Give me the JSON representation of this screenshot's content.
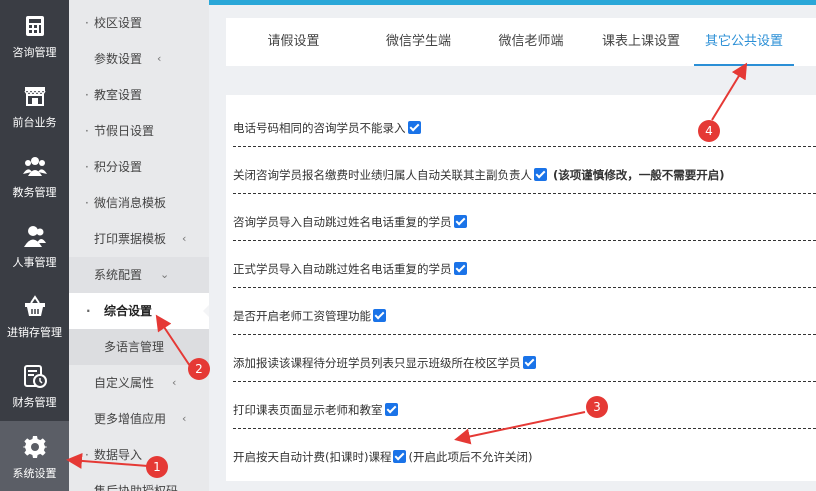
{
  "rail": [
    {
      "label": "咨询管理",
      "icon": "calculator-icon"
    },
    {
      "label": "前台业务",
      "icon": "storefront-icon"
    },
    {
      "label": "教务管理",
      "icon": "group-icon"
    },
    {
      "label": "人事管理",
      "icon": "people-icon"
    },
    {
      "label": "进销存管理",
      "icon": "basket-icon"
    },
    {
      "label": "财务管理",
      "icon": "finance-icon"
    },
    {
      "label": "系统设置",
      "icon": "gear-icon"
    }
  ],
  "submenu": [
    {
      "label": "校区设置"
    },
    {
      "label": "参数设置",
      "chevron": "‹"
    },
    {
      "label": "教室设置"
    },
    {
      "label": "节假日设置"
    },
    {
      "label": "积分设置"
    },
    {
      "label": "微信消息模板"
    },
    {
      "label": "打印票据模板",
      "chevron": "‹"
    },
    {
      "label": "系统配置",
      "chevron": "⌄"
    },
    {
      "label": "综合设置"
    },
    {
      "label": "多语言管理"
    },
    {
      "label": "自定义属性",
      "chevron": "‹"
    },
    {
      "label": "更多增值应用",
      "chevron": "‹"
    },
    {
      "label": "数据导入"
    },
    {
      "label": "售后协助授权码"
    }
  ],
  "tabs": [
    "请假设置",
    "微信学生端",
    "微信老师端",
    "课表上课设置",
    "其它公共设置"
  ],
  "settings": [
    {
      "text": "电话号码相同的咨询学员不能录入",
      "checked": true,
      "note": ""
    },
    {
      "text": "关闭咨询学员报名缴费时业绩归属人自动关联其主副负责人",
      "checked": true,
      "note": "(该项谨慎修改，一般不需要开启)"
    },
    {
      "text": "咨询学员导入自动跳过姓名电话重复的学员",
      "checked": true,
      "note": ""
    },
    {
      "text": "正式学员导入自动跳过姓名电话重复的学员",
      "checked": true,
      "note": ""
    },
    {
      "text": "是否开启老师工资管理功能",
      "checked": true,
      "note": ""
    },
    {
      "text": "添加报读该课程待分班学员列表只显示班级所在校区学员",
      "checked": true,
      "note": ""
    },
    {
      "text": "打印课表页面显示老师和教室",
      "checked": true,
      "note": ""
    },
    {
      "text": "开启按天自动计费(扣课时)课程",
      "checked": true,
      "note": "(开启此项后不允许关闭)"
    }
  ],
  "badges": [
    "1",
    "2",
    "3",
    "4"
  ],
  "colors": {
    "accent": "#2b8fd6",
    "rail": "#3a3d44",
    "badge": "#e53935",
    "checkbox": "#1a73e8"
  }
}
